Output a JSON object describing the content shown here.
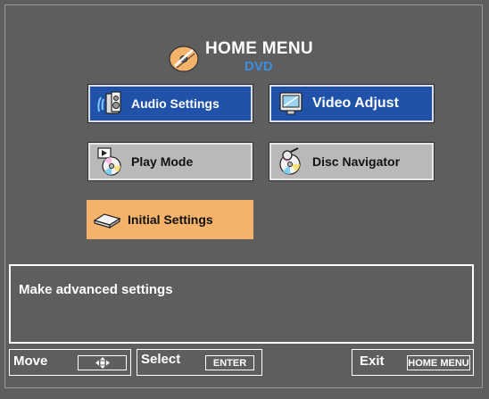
{
  "header": {
    "title": "HOME MENU",
    "subtitle": "DVD",
    "logo_icon": "dvd-disc-logo-icon"
  },
  "menu": {
    "items": [
      {
        "label": "Audio Settings",
        "icon": "speaker-icon",
        "state": "highlighted"
      },
      {
        "label": "Video Adjust",
        "icon": "monitor-icon",
        "state": "highlighted"
      },
      {
        "label": "Play Mode",
        "icon": "play-disc-icon",
        "state": "normal"
      },
      {
        "label": "Disc Navigator",
        "icon": "disc-magnifier-icon",
        "state": "normal"
      },
      {
        "label": "Initial Settings",
        "icon": "player-device-icon",
        "state": "selected"
      }
    ]
  },
  "info": {
    "text": "Make advanced settings"
  },
  "footer": {
    "move_label": "Move",
    "move_key_icon": "four-way-arrow-icon",
    "select_label": "Select",
    "select_key": "ENTER",
    "exit_label": "Exit",
    "exit_key": "HOME MENU"
  },
  "colors": {
    "background": "#5e5e5e",
    "highlight_blue": "#1f52a8",
    "normal_grey": "#b9b9b9",
    "selected_orange": "#f4b26a",
    "subtitle_blue": "#3a8fe0"
  }
}
